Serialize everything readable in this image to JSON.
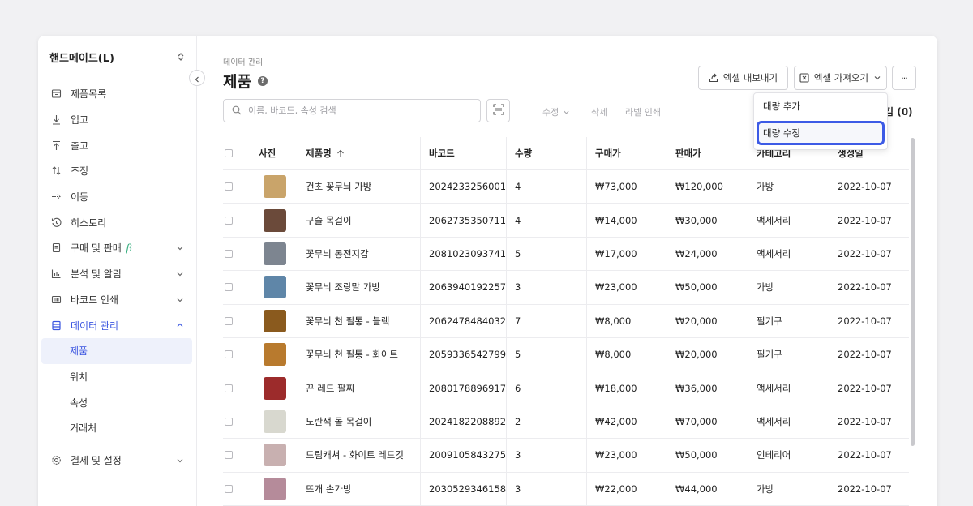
{
  "sidebar": {
    "store_name": "핸드메이드(L)",
    "items": [
      {
        "label": "제품목록",
        "icon": "box-icon"
      },
      {
        "label": "입고",
        "icon": "arrow-down-icon"
      },
      {
        "label": "출고",
        "icon": "arrow-up-icon"
      },
      {
        "label": "조정",
        "icon": "adjust-arrows-icon"
      },
      {
        "label": "이동",
        "icon": "arrow-right-icon"
      },
      {
        "label": "히스토리",
        "icon": "history-icon"
      },
      {
        "label": "구매 및 판매",
        "icon": "document-icon",
        "badge": "β"
      },
      {
        "label": "분석 및 알림",
        "icon": "bar-chart-icon"
      },
      {
        "label": "바코드 인쇄",
        "icon": "barcode-icon"
      },
      {
        "label": "데이터 관리",
        "icon": "database-icon"
      }
    ],
    "sub_items": [
      "제품",
      "위치",
      "속성",
      "거래처"
    ],
    "settings_label": "결제 및 설정"
  },
  "header": {
    "breadcrumb": "데이터 관리",
    "title": "제품",
    "export_label": "엑셀 내보내기",
    "import_label": "엑셀 가져오기",
    "more_label": "···"
  },
  "toolbar": {
    "search_placeholder": "이름, 바코드, 속성 검색",
    "edit_label": "수정",
    "delete_label": "삭제",
    "label_print": "라벨 인쇄",
    "selected_count": "김 (0)"
  },
  "dropdown": {
    "items": [
      "대량 추가",
      "대량 수정"
    ]
  },
  "table": {
    "headers": [
      "사진",
      "제품명",
      "바코드",
      "수량",
      "구매가",
      "판매가",
      "카테고리",
      "생성일"
    ],
    "sort_icon": "arrow-up-icon",
    "rows": [
      {
        "name": "건초 꽃무늬 가방",
        "barcode": "2024233256001",
        "qty": "4",
        "buy": "₩73,000",
        "sell": "₩120,000",
        "category": "가방",
        "date": "2022-10-07",
        "thumb": "#c9a46a"
      },
      {
        "name": "구슬 목걸이",
        "barcode": "2062735350711",
        "qty": "4",
        "buy": "₩14,000",
        "sell": "₩30,000",
        "category": "액세서리",
        "date": "2022-10-07",
        "thumb": "#6b4a3a"
      },
      {
        "name": "꽃무늬 동전지갑",
        "barcode": "2081023093741",
        "qty": "5",
        "buy": "₩17,000",
        "sell": "₩24,000",
        "category": "액세서리",
        "date": "2022-10-07",
        "thumb": "#7d8590"
      },
      {
        "name": "꽃무늬 조랑말 가방",
        "barcode": "2063940192257",
        "qty": "3",
        "buy": "₩23,000",
        "sell": "₩50,000",
        "category": "가방",
        "date": "2022-10-07",
        "thumb": "#5f86a8"
      },
      {
        "name": "꽃무늬 천 필통 - 블랙",
        "barcode": "2062478484032",
        "qty": "7",
        "buy": "₩8,000",
        "sell": "₩20,000",
        "category": "필기구",
        "date": "2022-10-07",
        "thumb": "#8a5a1e"
      },
      {
        "name": "꽃무늬 천 필통 - 화이트",
        "barcode": "2059336542799",
        "qty": "5",
        "buy": "₩8,000",
        "sell": "₩20,000",
        "category": "필기구",
        "date": "2022-10-07",
        "thumb": "#b87a2e"
      },
      {
        "name": "끈 레드 팔찌",
        "barcode": "2080178896917",
        "qty": "6",
        "buy": "₩18,000",
        "sell": "₩36,000",
        "category": "액세서리",
        "date": "2022-10-07",
        "thumb": "#9c2b2b"
      },
      {
        "name": "노란색 돌 목걸이",
        "barcode": "2024182208892",
        "qty": "2",
        "buy": "₩42,000",
        "sell": "₩70,000",
        "category": "액세서리",
        "date": "2022-10-07",
        "thumb": "#d8d8cf"
      },
      {
        "name": "드림캐쳐 - 화이트 레드깃",
        "barcode": "2009105843275",
        "qty": "3",
        "buy": "₩23,000",
        "sell": "₩50,000",
        "category": "인테리어",
        "date": "2022-10-07",
        "thumb": "#c8b0b0"
      },
      {
        "name": "뜨개 손가방",
        "barcode": "2030529346158",
        "qty": "3",
        "buy": "₩22,000",
        "sell": "₩44,000",
        "category": "가방",
        "date": "2022-10-07",
        "thumb": "#b58b9a"
      }
    ]
  },
  "colors": {
    "accent": "#3a55e0",
    "highlight_border": "#3d5be6",
    "beta": "#2aa876"
  }
}
